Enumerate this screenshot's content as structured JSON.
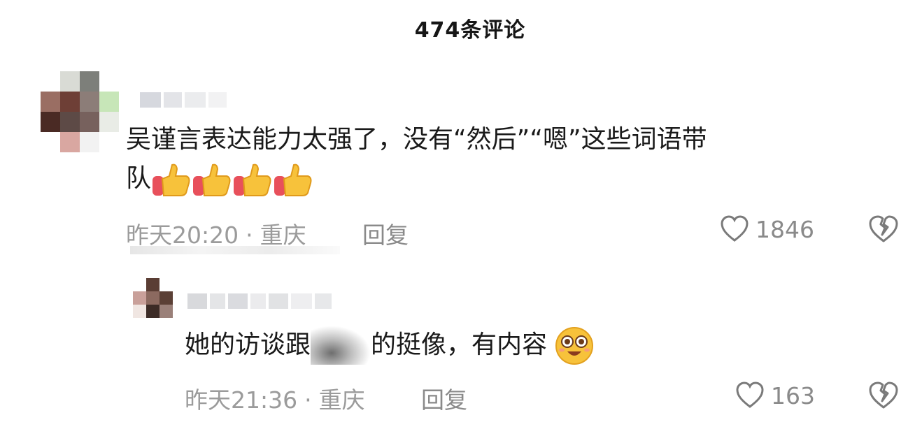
{
  "header": {
    "title": "474条评论"
  },
  "comments": [
    {
      "text_line1": "吴谨言表达能力太强了，没有“然后”“嗯”这些词语带",
      "text_line2": "队",
      "time": "昨天20:20",
      "location": "重庆",
      "reply_label": "回复",
      "likes": "1846",
      "reactions": [
        "thumbs-up-icon",
        "thumbs-up-icon",
        "thumbs-up-icon",
        "thumbs-up-icon"
      ]
    },
    {
      "text_part1": "她的访谈跟",
      "text_part2": "的挺像，有内容",
      "time": "昨天21:36",
      "location": "重庆",
      "reply_label": "回复",
      "likes": "163",
      "reaction": "star-eyes-emoji-icon"
    }
  ],
  "colors": {
    "meta": "#9b9b9b",
    "text": "#1a1a1a",
    "thumb": "#f5b82e"
  }
}
